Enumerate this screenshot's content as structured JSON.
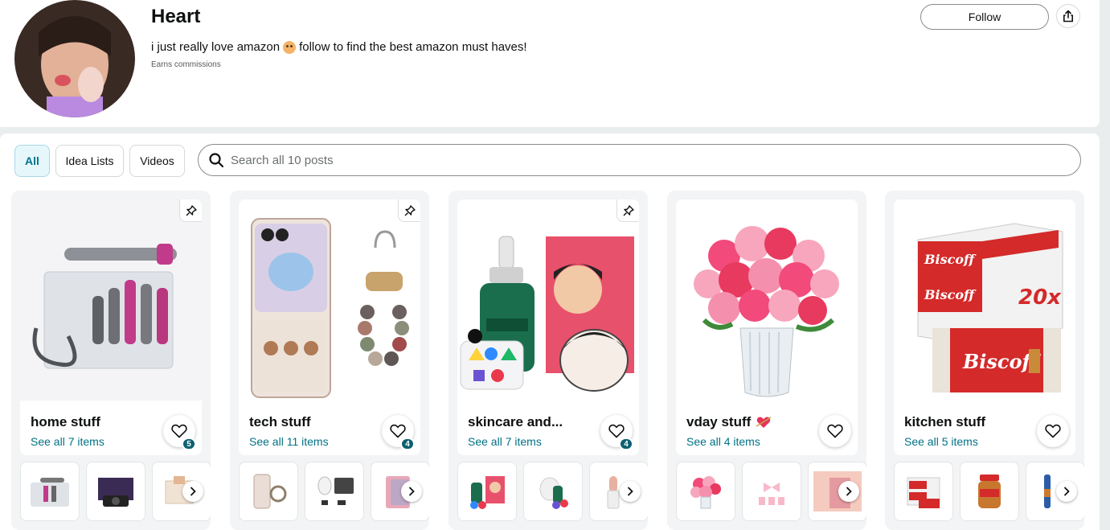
{
  "profile": {
    "name": "Heart",
    "bio_before": "i just really love amazon",
    "bio_after": "follow to find the best amazon must haves!",
    "disclosure": "Earns commissions",
    "follow_label": "Follow"
  },
  "filters": {
    "tabs": [
      {
        "label": "All",
        "active": true
      },
      {
        "label": "Idea Lists",
        "active": false
      },
      {
        "label": "Videos",
        "active": false
      }
    ],
    "search_placeholder": "Search all 10 posts"
  },
  "posts": [
    {
      "title": "home stuff",
      "subtitle": "See all 7 items",
      "likes": "5",
      "pinned": true
    },
    {
      "title": "tech stuff",
      "subtitle": "See all 11 items",
      "likes": "4",
      "pinned": true
    },
    {
      "title": "skincare and...",
      "subtitle": "See all 7 items",
      "likes": "4",
      "pinned": true
    },
    {
      "title": "vday stuff",
      "subtitle": "See all 4 items",
      "likes": "",
      "pinned": false
    },
    {
      "title": "kitchen stuff",
      "subtitle": "See all 5 items",
      "likes": "",
      "pinned": false
    }
  ],
  "colors": {
    "link": "#007185",
    "badge": "#0d6070",
    "active_tab_bg": "#e6f7fb"
  }
}
